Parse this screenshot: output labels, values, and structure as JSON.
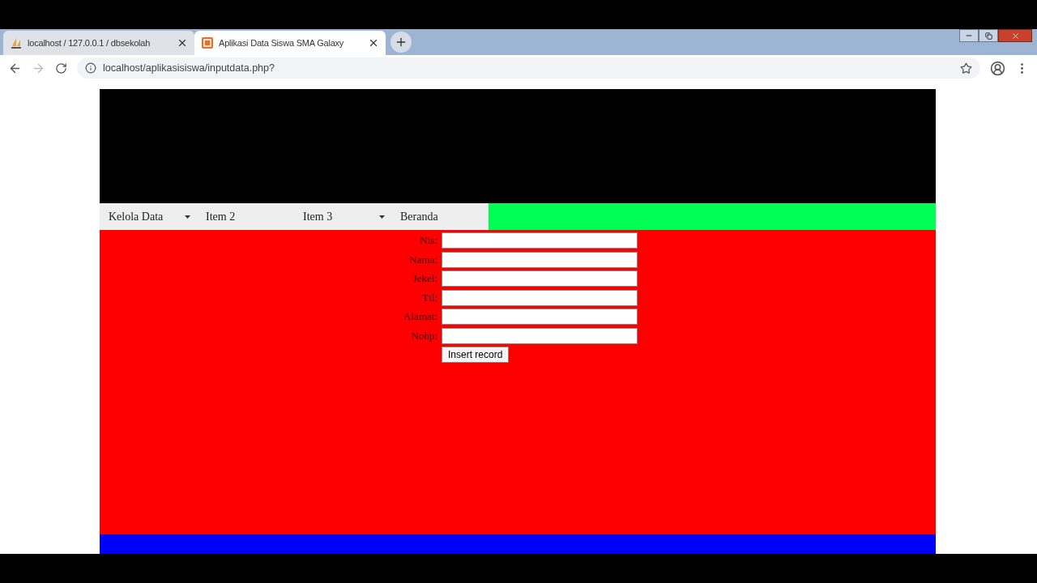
{
  "browser": {
    "tabs": [
      {
        "title": "localhost / 127.0.0.1 / dbsekolah",
        "selected": false
      },
      {
        "title": "Aplikasi Data Siswa SMA Galaxy",
        "selected": true
      }
    ],
    "url": "localhost/aplikasisiswa/inputdata.php?"
  },
  "nav": {
    "items": [
      {
        "label": "Kelola Data",
        "has_dropdown": true
      },
      {
        "label": "Item 2",
        "has_dropdown": false
      },
      {
        "label": "Item 3",
        "has_dropdown": true
      },
      {
        "label": "Beranda",
        "has_dropdown": false
      }
    ]
  },
  "form": {
    "fields": [
      {
        "label": "Nis:"
      },
      {
        "label": "Nama:"
      },
      {
        "label": "Jekel:"
      },
      {
        "label": "Ttl:"
      },
      {
        "label": "Alamat:"
      },
      {
        "label": "Nohp:"
      }
    ],
    "submit": "Insert record"
  }
}
